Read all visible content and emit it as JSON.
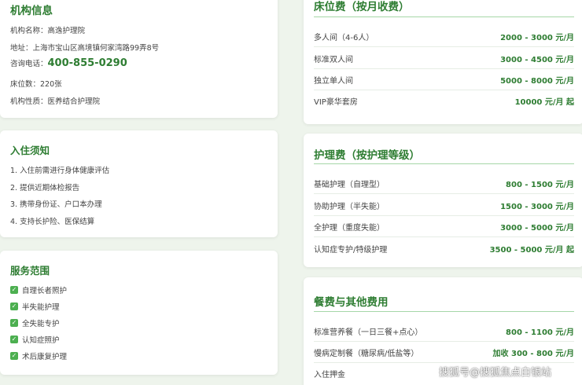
{
  "institution": {
    "title": "机构信息",
    "name_line": "机构名称：高逸护理院",
    "address_line": "地址：上海市宝山区高境镇何家湾路99弄8号",
    "phone_label": "咨询电话：",
    "phone": "400-855-0290",
    "beds_line": "床位数：220张",
    "nature_line": "机构性质：医养结合护理院"
  },
  "notice": {
    "title": "入住须知",
    "items": [
      "1. 入住前需进行身体健康评估",
      "2. 提供近期体检报告",
      "3. 携带身份证、户口本办理",
      "4. 支持长护险、医保结算"
    ]
  },
  "services": {
    "title": "服务范围",
    "items": [
      "自理长者照护",
      "半失能护理",
      "全失能专护",
      "认知症照护",
      "术后康复护理"
    ]
  },
  "bed_fee": {
    "title": "床位费（按月收费）",
    "rows": [
      {
        "label": "多人间（4-6人）",
        "price": "2000 - 3000 元/月"
      },
      {
        "label": "标准双人间",
        "price": "3000 - 4500 元/月"
      },
      {
        "label": "独立单人间",
        "price": "5000 - 8000 元/月"
      },
      {
        "label": "VIP豪华套房",
        "price": "10000 元/月 起"
      }
    ]
  },
  "care_fee": {
    "title": "护理费（按护理等级）",
    "rows": [
      {
        "label": "基础护理（自理型）",
        "price": "800 - 1500 元/月"
      },
      {
        "label": "协助护理（半失能）",
        "price": "1500 - 3000 元/月"
      },
      {
        "label": "全护理（重度失能）",
        "price": "3000 - 5000 元/月"
      },
      {
        "label": "认知症专护/特级护理",
        "price": "3500 - 5000 元/月 起"
      }
    ]
  },
  "meal_fee": {
    "title": "餐费与其他费用",
    "rows": [
      {
        "label": "标准营养餐（一日三餐+点心）",
        "price": "800 - 1100 元/月"
      },
      {
        "label": "慢病定制餐（糖尿病/低盐等）",
        "price": "加收 300 - 800 元/月"
      },
      {
        "label": "入住押金",
        "price": ""
      }
    ]
  },
  "watermark": "搜狐号@搜狐焦点白银站",
  "colors": {
    "accent": "#2e7d32",
    "check": "#4caf50",
    "page_bg": "#eef4ec"
  }
}
